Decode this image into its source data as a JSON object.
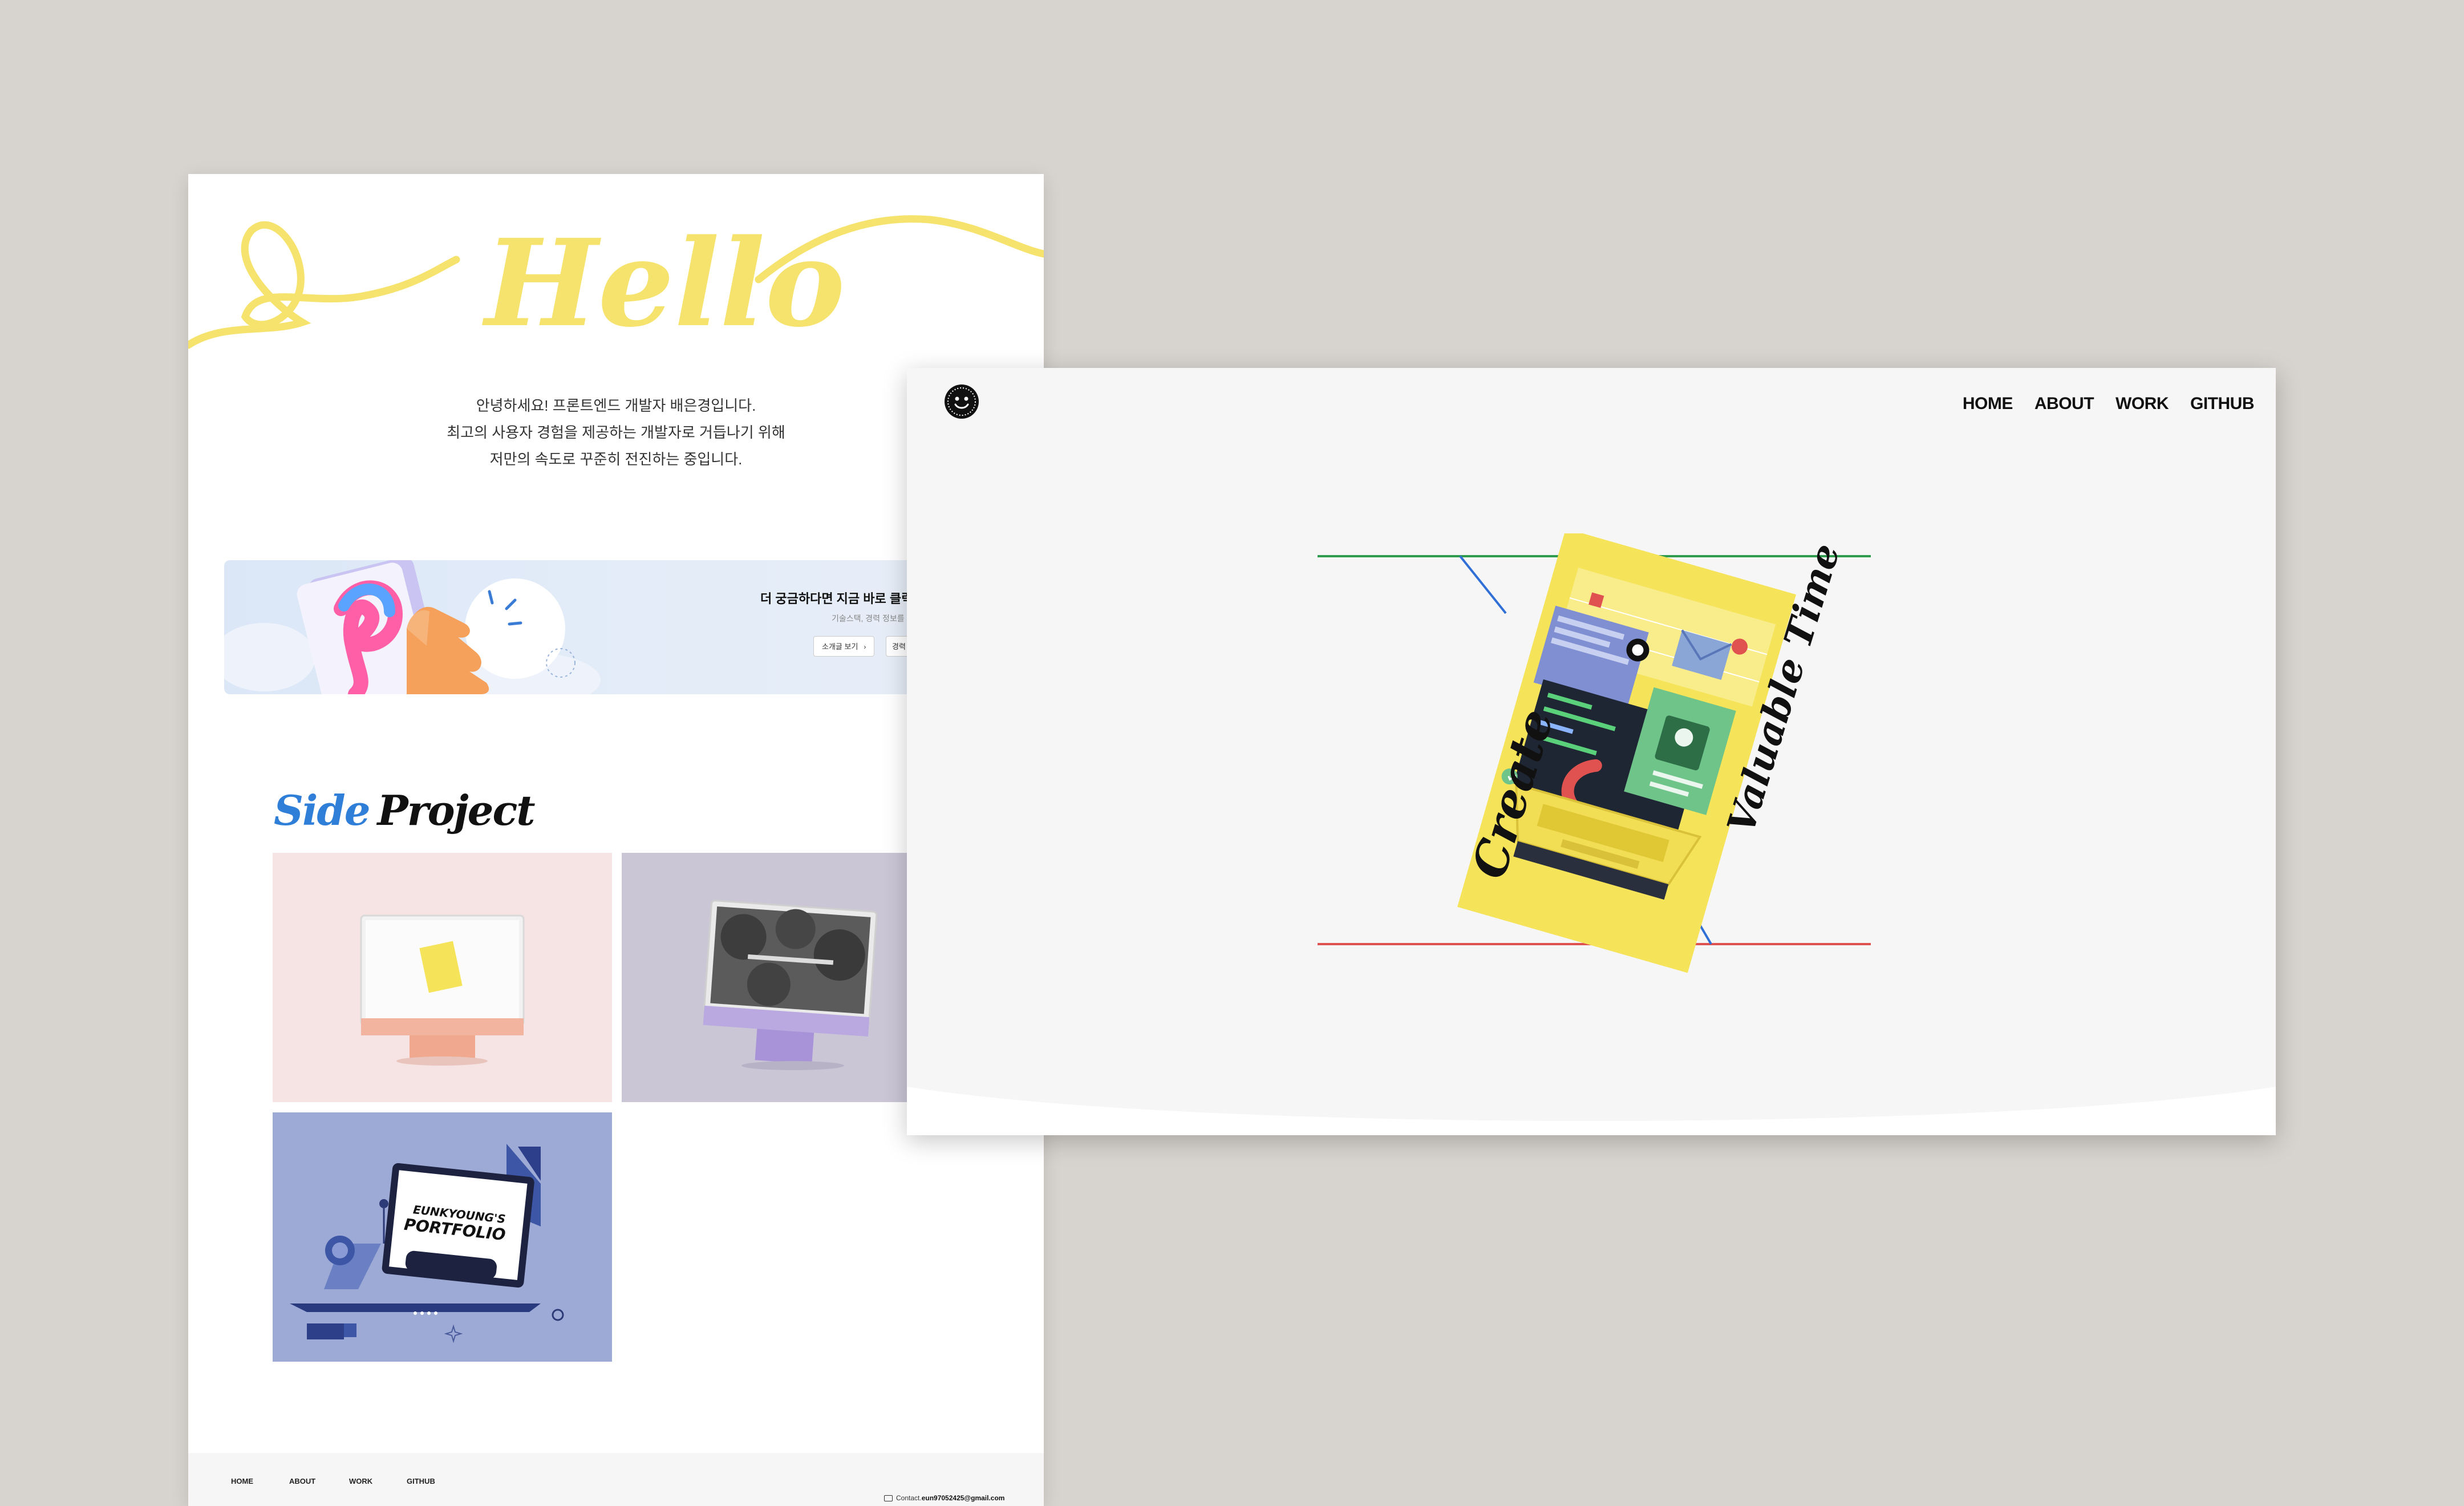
{
  "left_page": {
    "hero_word": "Hello",
    "intro_lines": [
      "안녕하세요! 프론트엔드 개발자 배은경입니다.",
      "최고의 사용자 경험을 제공하는 개발자로 거듭나기 위해",
      "저만의 속도로 꾸준히 전진하는 중입니다."
    ],
    "banner": {
      "title": "더 궁금하다면 지금 바로 클릭",
      "subtitle": "기술스택, 경력 정보를 ·",
      "button_1": "소개글 보기",
      "button_2": "경력"
    },
    "side_project": {
      "word_1": "Side",
      "word_2": "Project"
    },
    "cards": [
      {
        "color": "#f6e3e3",
        "device": "imac-pink"
      },
      {
        "color": "#cac6d6",
        "device": "imac-purple"
      },
      {
        "color": "#9eaad6",
        "device": "laptop",
        "screen_line_1": "EUNKYOUNG'S",
        "screen_line_2": "PORTFOLIO"
      }
    ],
    "footer": {
      "links": [
        "HOME",
        "ABOUT",
        "WORK",
        "GITHUB"
      ],
      "contact_label": "Contact.",
      "contact_email": "eun97052425@gmail.com"
    }
  },
  "right_page": {
    "nav": [
      "HOME",
      "ABOUT",
      "WORK",
      "GITHUB"
    ],
    "hero_text_left": "Create",
    "hero_text_right": "Valuable Time",
    "colors": {
      "green_line": "#2e9b4f",
      "red_line": "#e0524f",
      "blue_line": "#2f6fd6",
      "yellow_poster": "#f5e35a"
    }
  },
  "colors": {
    "background": "#d7d3cf",
    "hello_yellow": "#f5e36e",
    "side_blue": "#2f7ed8"
  }
}
